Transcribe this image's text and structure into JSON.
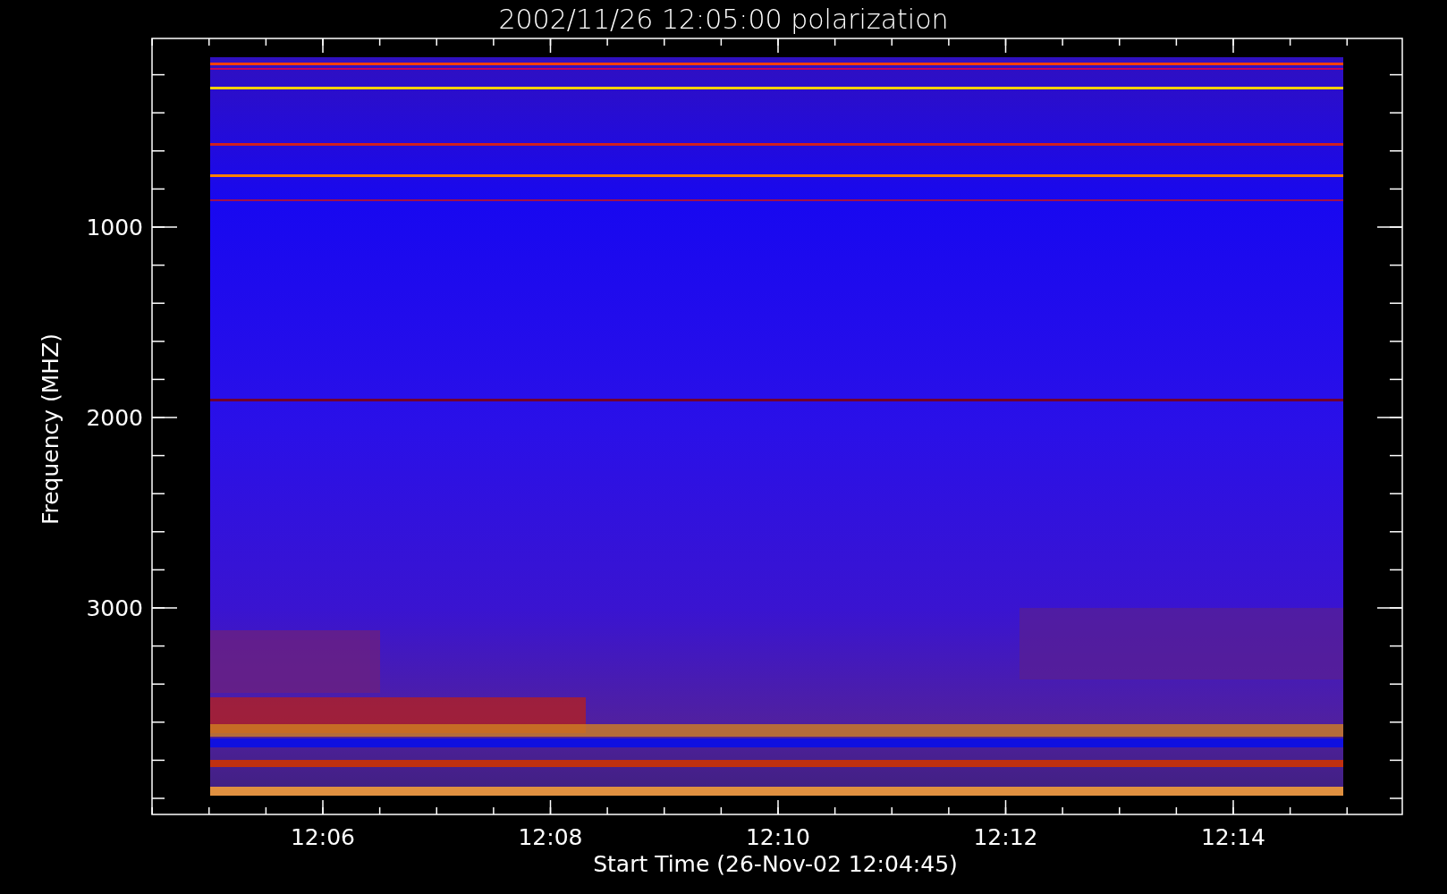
{
  "title": "2002/11/26 12:05:00 polarization",
  "xlabel": "Start Time (26-Nov-02 12:04:45)",
  "ylabel": "Frequency (MHZ)",
  "xticks": [
    {
      "label": "12:06"
    },
    {
      "label": "12:08"
    },
    {
      "label": "12:10"
    },
    {
      "label": "12:12"
    },
    {
      "label": "12:14"
    }
  ],
  "yticks": [
    {
      "label": "1000"
    },
    {
      "label": "2000"
    },
    {
      "label": "3000"
    }
  ]
}
